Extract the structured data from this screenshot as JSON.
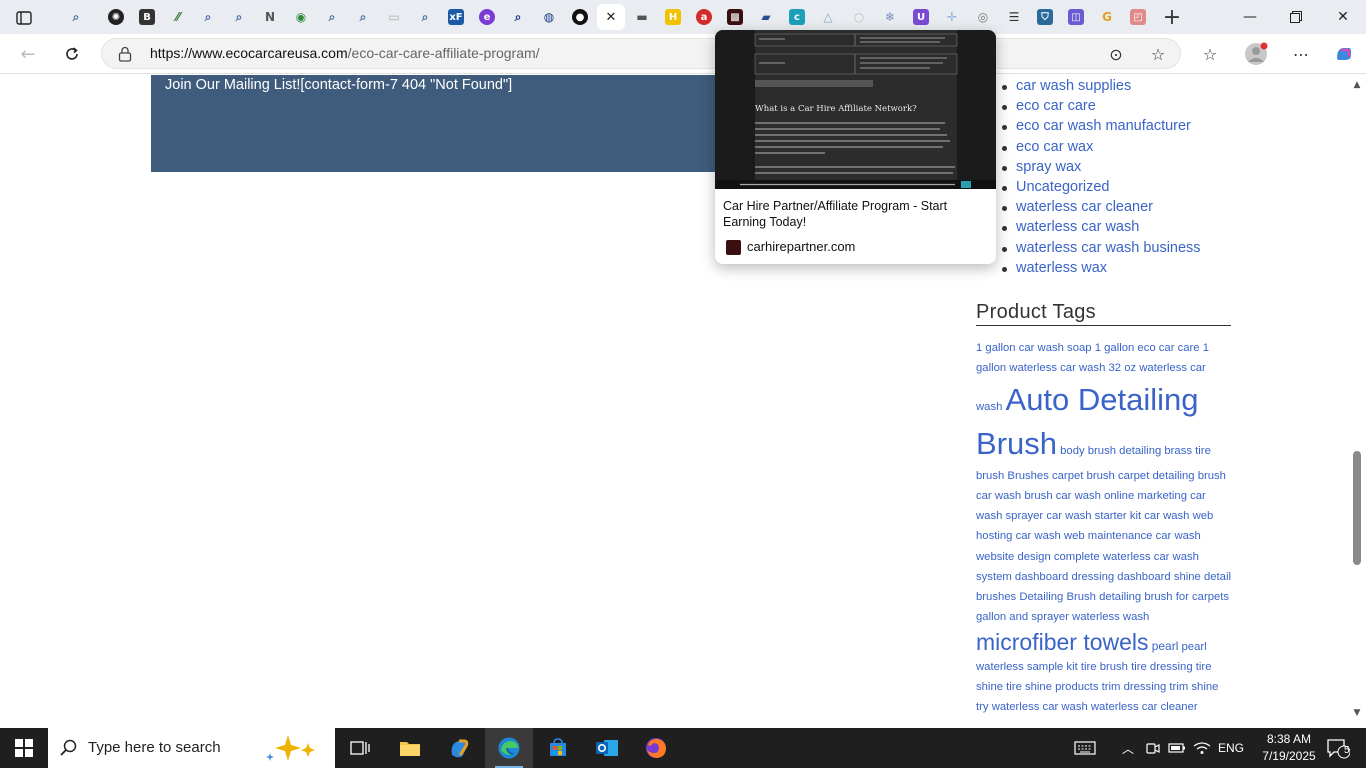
{
  "browser": {
    "tabs": [
      {
        "name": "search",
        "glyph": "⌕",
        "color": "#4a6fa5"
      },
      {
        "name": "openai",
        "glyph": "✺",
        "color": "#222222"
      },
      {
        "name": "bold-b",
        "glyph": "B",
        "color": "#333333"
      },
      {
        "name": "chart",
        "glyph": "⁄⁄",
        "color": "#3a7a3a"
      },
      {
        "name": "search",
        "glyph": "⌕",
        "color": "#4a6fa5"
      },
      {
        "name": "search",
        "glyph": "⌕",
        "color": "#4a6fa5"
      },
      {
        "name": "notion",
        "glyph": "N",
        "color": "#555555"
      },
      {
        "name": "maps",
        "glyph": "◉",
        "color": "#2f8a3d"
      },
      {
        "name": "search",
        "glyph": "⌕",
        "color": "#4a6fa5"
      },
      {
        "name": "search",
        "glyph": "⌕",
        "color": "#4a6fa5"
      },
      {
        "name": "blank",
        "glyph": "▭",
        "color": "#aaaaaa"
      },
      {
        "name": "search",
        "glyph": "⌕",
        "color": "#4a6fa5"
      },
      {
        "name": "xf",
        "glyph": "xF",
        "color": "#1a5aa8"
      },
      {
        "name": "e-purple",
        "glyph": "e",
        "color": "#7a3ad4"
      },
      {
        "name": "search",
        "glyph": "⌕",
        "color": "#1a3a8a"
      },
      {
        "name": "globe-blue",
        "glyph": "◍",
        "color": "#1a3a8a"
      },
      {
        "name": "github",
        "glyph": "●",
        "color": "#111111"
      },
      {
        "name": "active-close",
        "glyph": "✕",
        "color": "#222222"
      },
      {
        "name": "site-dark",
        "glyph": "▬",
        "color": "#555555"
      },
      {
        "name": "h-yellow",
        "glyph": "H",
        "color": "#f2c200"
      },
      {
        "name": "red-circle",
        "glyph": "a",
        "color": "#d42a2a"
      },
      {
        "name": "carhire",
        "glyph": "▩",
        "color": "#3b0f10"
      },
      {
        "name": "car",
        "glyph": "▰",
        "color": "#2a4a9a"
      },
      {
        "name": "c-teal",
        "glyph": "c",
        "color": "#1aa0b8"
      },
      {
        "name": "triangle",
        "glyph": "△",
        "color": "#7ab0b8"
      },
      {
        "name": "circle-light",
        "glyph": "○",
        "color": "#c0c0c0"
      },
      {
        "name": "snowflake",
        "glyph": "❄",
        "color": "#7a90c0"
      },
      {
        "name": "u-purple",
        "glyph": "U",
        "color": "#7a4ad4"
      },
      {
        "name": "plus-light",
        "glyph": "✛",
        "color": "#8ab0d8"
      },
      {
        "name": "globe",
        "glyph": "◎",
        "color": "#777777"
      },
      {
        "name": "list",
        "glyph": "☰",
        "color": "#333333"
      },
      {
        "name": "shield",
        "glyph": "⛉",
        "color": "#2a6a9a"
      },
      {
        "name": "chat",
        "glyph": "◫",
        "color": "#6a5ad4"
      },
      {
        "name": "google",
        "glyph": "G",
        "color": "#e0a020"
      },
      {
        "name": "pink",
        "glyph": "◰",
        "color": "#e08a8a"
      }
    ],
    "url_domain": "https://www.ecocarcareusa.com",
    "url_path": "/eco-car-care-affiliate-program/"
  },
  "page": {
    "mailing_text": "Join Our Mailing List![contact-form-7 404 \"Not Found\"]",
    "categories": [
      "car wash supplies",
      "eco car care",
      "eco car wash manufacturer",
      "eco car wax",
      "spray wax",
      "Uncategorized",
      "waterless car cleaner",
      "waterless car wash",
      "waterless car wash business",
      "waterless wax"
    ],
    "product_tags_title": "Product Tags",
    "tags": [
      {
        "t": "1 gallon car wash soap",
        "s": "sm"
      },
      {
        "t": "1 gallon eco car care",
        "s": "sm"
      },
      {
        "t": "1 gallon waterless car wash",
        "s": "sm"
      },
      {
        "t": "32 oz waterless car wash",
        "s": "sm"
      },
      {
        "t": "Auto Detailing Brush",
        "s": "xl"
      },
      {
        "t": "body brush",
        "s": "sm"
      },
      {
        "t": "detailing brass tire brush",
        "s": "sm"
      },
      {
        "t": "Brushes",
        "s": "sm"
      },
      {
        "t": "carpet brush",
        "s": "sm"
      },
      {
        "t": "carpet detailing brush",
        "s": "sm"
      },
      {
        "t": "car wash brush",
        "s": "sm"
      },
      {
        "t": "car wash online marketing",
        "s": "sm"
      },
      {
        "t": "car wash sprayer",
        "s": "sm"
      },
      {
        "t": "car wash starter kit",
        "s": "sm"
      },
      {
        "t": "car wash web hosting",
        "s": "sm"
      },
      {
        "t": "car wash web maintenance",
        "s": "sm"
      },
      {
        "t": "car wash website design",
        "s": "sm"
      },
      {
        "t": "complete waterless car wash system",
        "s": "sm"
      },
      {
        "t": "dashboard dressing",
        "s": "sm"
      },
      {
        "t": "dashboard shine detail brushes",
        "s": "sm"
      },
      {
        "t": "Detailing Brush",
        "s": "sm"
      },
      {
        "t": "detailing brush for carpets",
        "s": "sm"
      },
      {
        "t": "gallon and sprayer waterless wash",
        "s": "sm"
      },
      {
        "t": "microfiber towels",
        "s": "lg"
      },
      {
        "t": "pearl",
        "s": "md"
      },
      {
        "t": "pearl waterless",
        "s": "sm"
      },
      {
        "t": "sample kit",
        "s": "sm"
      },
      {
        "t": "tire brush",
        "s": "sm"
      },
      {
        "t": "tire dressing",
        "s": "sm"
      },
      {
        "t": "tire shine",
        "s": "sm"
      },
      {
        "t": "tire shine products",
        "s": "sm"
      },
      {
        "t": "trim dressing",
        "s": "sm"
      },
      {
        "t": "trim shine",
        "s": "sm"
      },
      {
        "t": "try waterless car wash",
        "s": "sm"
      },
      {
        "t": "waterless car cleaner",
        "s": "sm"
      }
    ]
  },
  "tab_preview": {
    "title": "Car Hire Partner/Affiliate Program - Start Earning Today!",
    "domain": "carhirepartner.com",
    "thumb_heading": "What is a Car Hire Affiliate Network?"
  },
  "taskbar": {
    "search_placeholder": "Type here to search",
    "language": "ENG",
    "time": "8:38 AM",
    "date": "7/19/2025",
    "notification_count": "5"
  },
  "colors": {
    "accent": "#3a64c8",
    "mailing_bg": "#3f5c7c",
    "taskbar": "#1f1f1f"
  }
}
